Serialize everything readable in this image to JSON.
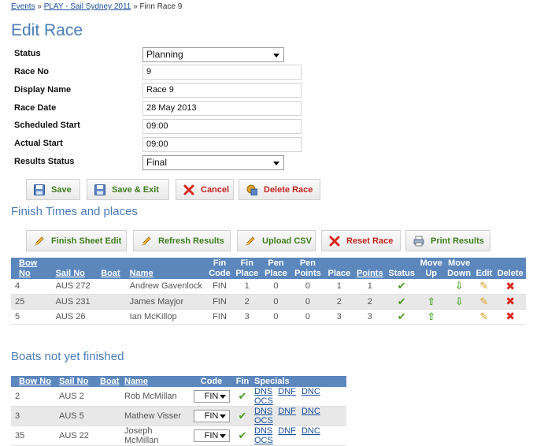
{
  "breadcrumb": {
    "events": "Events",
    "sep1": "»",
    "regatta": "PLAY - Sail Sydney 2011",
    "sep2": "»",
    "current": "Finn Race 9"
  },
  "page_title": "Edit Race",
  "form": {
    "status": {
      "label": "Status",
      "value": "Planning"
    },
    "race_no": {
      "label": "Race No",
      "value": "9"
    },
    "display_name": {
      "label": "Display Name",
      "value": "Race 9"
    },
    "race_date": {
      "label": "Race Date",
      "value": "28 May 2013"
    },
    "scheduled_start": {
      "label": "Scheduled Start",
      "value": "09:00"
    },
    "actual_start": {
      "label": "Actual Start",
      "value": "09:00"
    },
    "results_status": {
      "label": "Results Status",
      "value": "Final"
    }
  },
  "actions": {
    "save": "Save",
    "save_exit": "Save & Exit",
    "cancel": "Cancel",
    "delete": "Delete Race"
  },
  "finish_section": {
    "title": "Finish Times and places",
    "buttons": {
      "finish_sheet": "Finish Sheet Edit",
      "refresh": "Refresh Results",
      "upload": "Upload CSV",
      "reset": "Reset Race",
      "print": "Print Results"
    },
    "headers": {
      "bow_no": "Bow No",
      "sail_no": "Sail No",
      "boat": "Boat",
      "name": "Name",
      "fin_code_1": "Fin",
      "fin_code_2": "Code",
      "fin_place_1": "Fin",
      "fin_place_2": "Place",
      "pen_place_1": "Pen",
      "pen_place_2": "Place",
      "pen_points_1": "Pen",
      "pen_points_2": "Points",
      "place": "Place",
      "points": "Points",
      "status": "Status",
      "move_up_1": "Move",
      "move_up_2": "Up",
      "move_down_1": "Move",
      "move_down_2": "Down",
      "edit": "Edit",
      "delete": "Delete"
    },
    "rows": [
      {
        "bow": "4",
        "sail": "AUS 272",
        "boat": "",
        "name": "Andrew Gavenlock",
        "code": "FIN",
        "fin_place": "1",
        "pen_place": "0",
        "pen_points": "0",
        "place": "1",
        "points": "1"
      },
      {
        "bow": "25",
        "sail": "AUS 231",
        "boat": "",
        "name": "James Mayjor",
        "code": "FIN",
        "fin_place": "2",
        "pen_place": "0",
        "pen_points": "0",
        "place": "2",
        "points": "2"
      },
      {
        "bow": "5",
        "sail": "AUS 26",
        "boat": "",
        "name": "Ian McKillop",
        "code": "FIN",
        "fin_place": "3",
        "pen_place": "0",
        "pen_points": "0",
        "place": "3",
        "points": "3"
      }
    ]
  },
  "unfinished_section": {
    "title": "Boats not yet finished",
    "headers": {
      "bow_no": "Bow No",
      "sail_no": "Sail No",
      "boat": "Boat",
      "name": "Name",
      "code": "Code",
      "fin": "Fin",
      "specials": "Specials"
    },
    "specials": [
      "DNS",
      "DNF",
      "DNC",
      "OCS"
    ],
    "rows": [
      {
        "bow": "2",
        "sail": "AUS 2",
        "boat": "",
        "name": "Rob McMillan",
        "code": "FIN"
      },
      {
        "bow": "3",
        "sail": "AUS 5",
        "boat": "",
        "name": "Mathew Visser",
        "code": "FIN"
      },
      {
        "bow": "35",
        "sail": "AUS 22",
        "boat": "",
        "name": "Joseph McMillan",
        "code": "FIN"
      }
    ]
  },
  "icons": {
    "save": "floppy-disk-icon",
    "cancel": "x-icon",
    "delete": "delete-race-icon",
    "edit": "pencil-icon",
    "reset": "x-icon",
    "print": "printer-icon",
    "status_ok": "check-icon",
    "move_up": "arrow-up-icon",
    "move_down": "arrow-down-icon",
    "row_delete": "x-icon"
  },
  "colors": {
    "header_bg": "#5b87bd",
    "title": "#4a7db8",
    "link": "#1a4f9c",
    "ok": "#4a9d22",
    "danger": "#d8261d"
  }
}
